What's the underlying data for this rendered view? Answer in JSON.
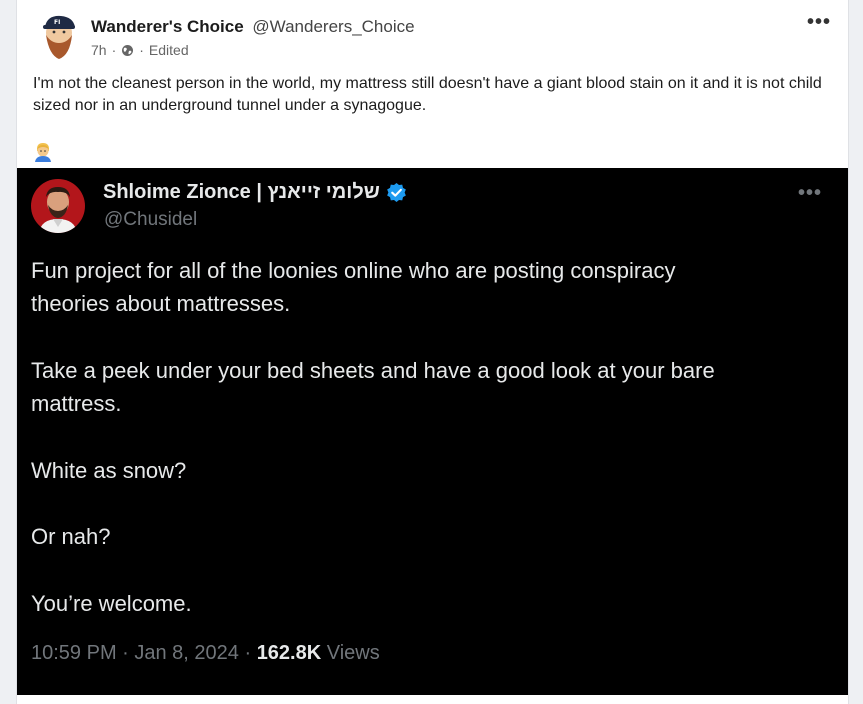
{
  "post": {
    "author_name": "Wanderer's Choice",
    "author_handle": "@Wanderers_Choice",
    "time": "7h",
    "dot": "·",
    "edited": "Edited",
    "more": "•••",
    "text": "I'm not the cleanest person in the world, my mattress still doesn't have a giant blood stain on it and it is not child sized nor in an underground tunnel under a synagogue."
  },
  "embed": {
    "name": "Shloime Zionce | שלומי זייאנץ",
    "handle": "@Chusidel",
    "more": "•••",
    "lines": [
      "Fun project for all of the loonies online who are posting conspiracy",
      "theories about mattresses.",
      "Take a peek under your bed sheets and have a good look at your bare",
      "mattress.",
      "White as snow?",
      "Or nah?",
      "You’re welcome."
    ],
    "time": "10:59 PM · Jan 8, 2024 · ",
    "views_count": "162.8K",
    "views_label": " Views"
  },
  "icons": {
    "globe": "globe-icon",
    "verified": "verified-badge-icon",
    "emoji": "man-emoji-icon"
  },
  "colors": {
    "verified": "#1d9bf0",
    "embed_bg": "#000000",
    "embed_text": "#e7e9ea",
    "embed_muted": "#71767b"
  }
}
